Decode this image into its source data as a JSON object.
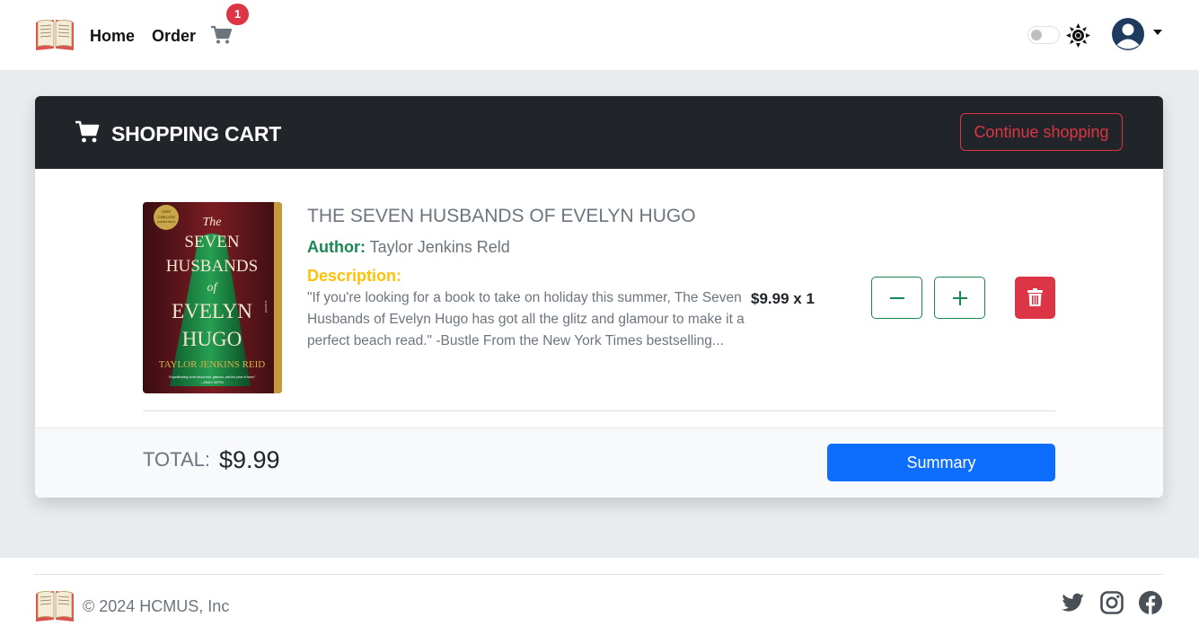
{
  "nav": {
    "home_label": "Home",
    "order_label": "Order",
    "cart_count": "1"
  },
  "cart": {
    "title": "SHOPPING CART",
    "continue_label": "Continue shopping",
    "items": [
      {
        "cover_lines": [
          "The",
          "SEVEN",
          "HUSBANDS",
          "of",
          "EVELYN",
          "HUGO",
          "TAYLOR JENKINS REID"
        ],
        "cover_badge": "OVER 2 MILLION COPIES SOLD",
        "cover_tag": "a novel",
        "cover_quote": "\"A spellbinding novel about love, glamour, and the price of fame.\"",
        "cover_quote_author": "—EMILY GIFFIN",
        "title": "THE SEVEN HUSBANDS OF EVELYN HUGO",
        "author_label": "Author:",
        "author": "Taylor Jenkins Reld",
        "description_label": "Description:",
        "description": "\"If you're looking for a book to take on holiday this summer, The Seven Husbands of Evelyn Hugo has got all the glitz and glamour to make it a perfect beach read.\" -Bustle From the New York Times bestselling...",
        "price_qty": "$9.99 x 1"
      }
    ],
    "total_label": "TOTAL:",
    "total_value": "$9.99",
    "summary_label": "Summary"
  },
  "footer": {
    "copyright": "© 2024 HCMUS, Inc"
  },
  "colors": {
    "header_dark": "#212529",
    "danger": "#dc3545",
    "success": "#198754",
    "warning": "#ffc107",
    "primary": "#0d6efd"
  }
}
